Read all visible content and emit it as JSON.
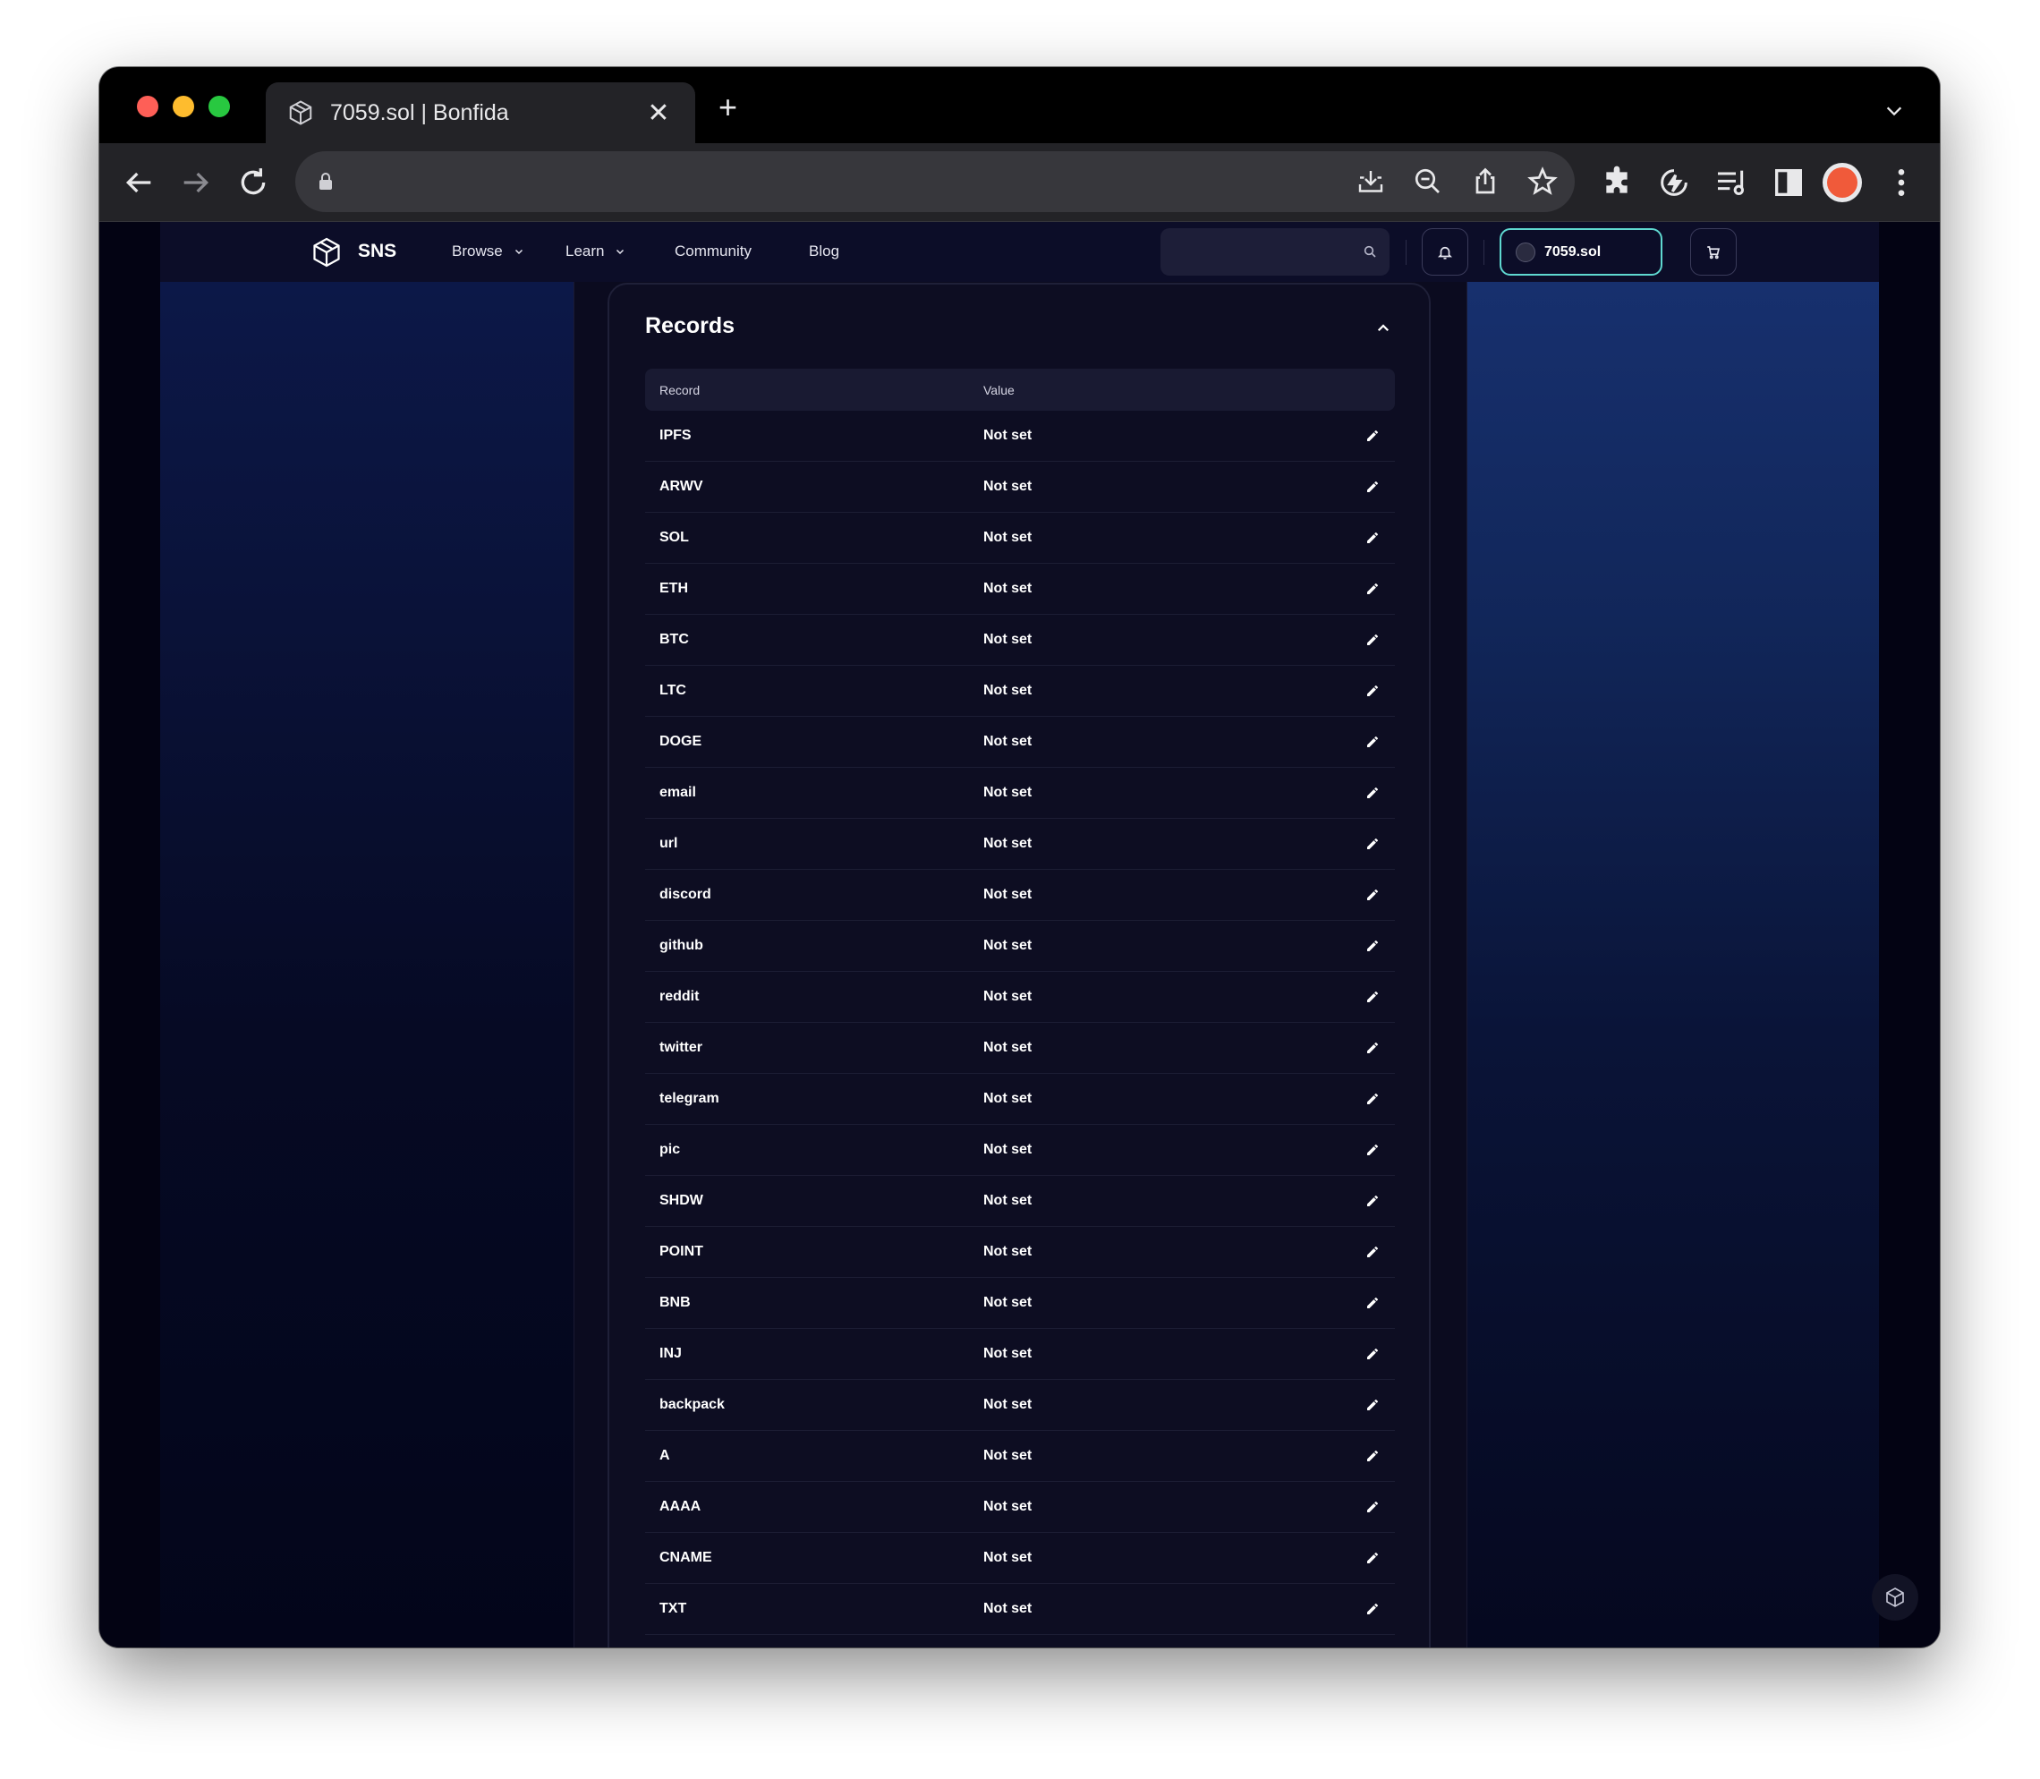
{
  "browser": {
    "tab_title": "7059.sol | Bonfida",
    "new_tab_symbol": "+",
    "close_symbol": "✕",
    "url": ""
  },
  "nav": {
    "brand": "SNS",
    "items": [
      {
        "label": "Browse",
        "dropdown": true
      },
      {
        "label": "Learn",
        "dropdown": true
      },
      {
        "label": "Community",
        "dropdown": false
      },
      {
        "label": "Blog",
        "dropdown": false
      }
    ],
    "search_placeholder": "",
    "wallet_label": "7059.sol"
  },
  "records": {
    "title": "Records",
    "headers": {
      "record": "Record",
      "value": "Value"
    },
    "rows": [
      {
        "record": "IPFS",
        "value": "Not set"
      },
      {
        "record": "ARWV",
        "value": "Not set"
      },
      {
        "record": "SOL",
        "value": "Not set"
      },
      {
        "record": "ETH",
        "value": "Not set"
      },
      {
        "record": "BTC",
        "value": "Not set"
      },
      {
        "record": "LTC",
        "value": "Not set"
      },
      {
        "record": "DOGE",
        "value": "Not set"
      },
      {
        "record": "email",
        "value": "Not set"
      },
      {
        "record": "url",
        "value": "Not set"
      },
      {
        "record": "discord",
        "value": "Not set"
      },
      {
        "record": "github",
        "value": "Not set"
      },
      {
        "record": "reddit",
        "value": "Not set"
      },
      {
        "record": "twitter",
        "value": "Not set"
      },
      {
        "record": "telegram",
        "value": "Not set"
      },
      {
        "record": "pic",
        "value": "Not set"
      },
      {
        "record": "SHDW",
        "value": "Not set"
      },
      {
        "record": "POINT",
        "value": "Not set"
      },
      {
        "record": "BNB",
        "value": "Not set"
      },
      {
        "record": "INJ",
        "value": "Not set"
      },
      {
        "record": "backpack",
        "value": "Not set"
      },
      {
        "record": "A",
        "value": "Not set"
      },
      {
        "record": "AAAA",
        "value": "Not set"
      },
      {
        "record": "CNAME",
        "value": "Not set"
      },
      {
        "record": "TXT",
        "value": "Not set"
      }
    ]
  },
  "colors": {
    "accent": "#5fd8d0",
    "page_bg": "#030313",
    "card_bg": "#0d0d22"
  }
}
